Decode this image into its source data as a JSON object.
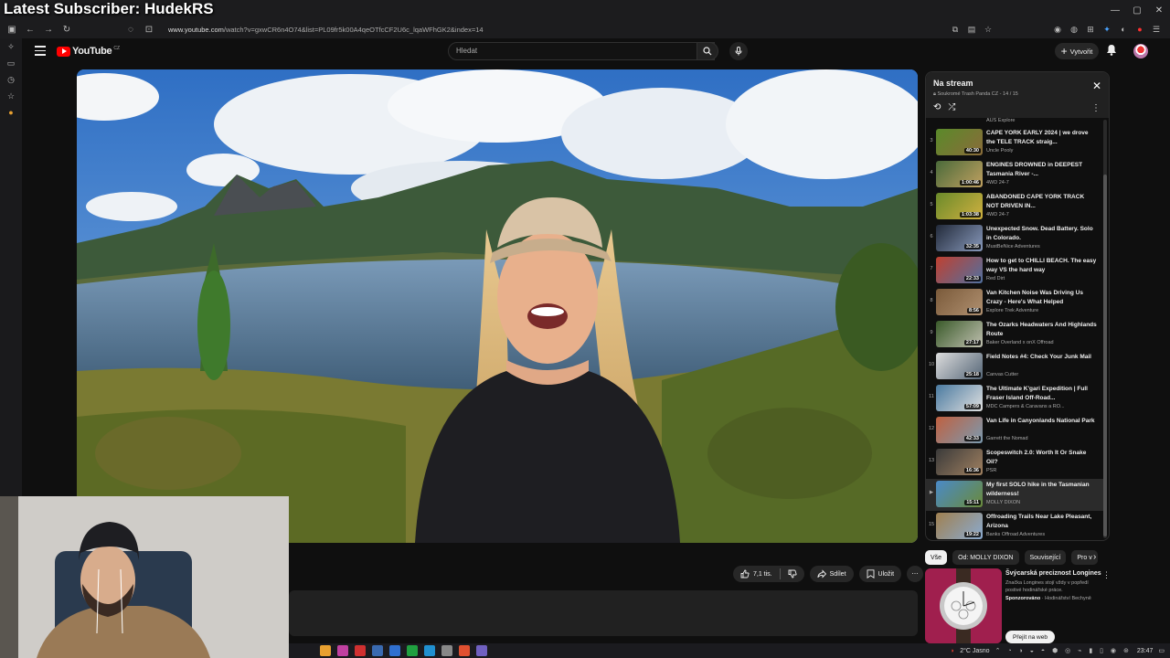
{
  "overlay": {
    "title": "Latest Subscriber: HudekRS"
  },
  "browser": {
    "url_host": "www.youtube.com",
    "url_path": "/watch?v=gxwCR6n4O74&list=PL09fr5k00A4qeOTfcCF2U6c_lqaWFhGK2&index=14"
  },
  "youtube": {
    "logo_text": "YouTube",
    "logo_region": "CZ",
    "search_placeholder": "Hledat",
    "create_label": "Vytvořit"
  },
  "actions": {
    "like_count": "7,1 tis.",
    "share_label": "Sdílet",
    "save_label": "Uložit"
  },
  "playlist": {
    "title": "Na stream",
    "privacy": "Soukromé",
    "owner": "Trash Panda CZ",
    "position": "14 / 15",
    "above_channel": "AUS Explore",
    "items": [
      {
        "index": "3",
        "title": "CAPE YORK EARLY 2024 | we drove the TELE TRACK straig...",
        "channel": "Uncle Pooly",
        "duration": "40:30",
        "colors": [
          "#5a8a2a",
          "#8a6b3a"
        ],
        "active": false
      },
      {
        "index": "4",
        "title": "ENGINES DROWNED in DEEPEST Tasmania River -...",
        "channel": "4WD 24-7",
        "duration": "1:00:46",
        "colors": [
          "#4a6a3a",
          "#c0a060"
        ],
        "active": false
      },
      {
        "index": "5",
        "title": "ABANDONED CAPE YORK TRACK NOT DRIVEN IN...",
        "channel": "4WD 24-7",
        "duration": "1:03:38",
        "colors": [
          "#6a8a2a",
          "#d0b040"
        ],
        "active": false
      },
      {
        "index": "6",
        "title": "Unexpected Snow. Dead Battery. Solo in Colorado.",
        "channel": "MustBeNice Adventures",
        "duration": "32:35",
        "colors": [
          "#222a3a",
          "#8899bb"
        ],
        "active": false
      },
      {
        "index": "7",
        "title": "How to get to CHILLI BEACH. The easy way VS the hard way",
        "channel": "Red Dirt",
        "duration": "22:33",
        "colors": [
          "#c04030",
          "#5070a0"
        ],
        "active": false
      },
      {
        "index": "8",
        "title": "Van Kitchen Noise Was Driving Us Crazy - Here's What Helped",
        "channel": "Explore Trek Adventure",
        "duration": "8:56",
        "colors": [
          "#7a5a3a",
          "#b09070"
        ],
        "active": false
      },
      {
        "index": "9",
        "title": "The Ozarks Headwaters And Highlands Route",
        "channel": "Baker Overland x onX Offroad",
        "duration": "27:17",
        "colors": [
          "#3a5a2a",
          "#c0c0b0"
        ],
        "active": false
      },
      {
        "index": "10",
        "title": "Field Notes #4: Check Your Junk Mail",
        "channel": "Canvas Cutter",
        "duration": "25:18",
        "colors": [
          "#dddddd",
          "#556677"
        ],
        "active": false
      },
      {
        "index": "11",
        "title": "The Ultimate K'gari Expedition | Full Fraser Island Off-Road...",
        "channel": "MDC Campers & Caravans a RO...",
        "duration": "57:09",
        "colors": [
          "#4a7aa0",
          "#e0e0e0"
        ],
        "active": false
      },
      {
        "index": "12",
        "title": "Van Life in Canyonlands National Park",
        "channel": "Garrett the Nomad",
        "duration": "42:33",
        "colors": [
          "#c06040",
          "#7a9ab0"
        ],
        "active": false
      },
      {
        "index": "13",
        "title": "Scopeswitch 2.0: Worth It Or Snake Oil?",
        "channel": "PSR",
        "duration": "16:36",
        "colors": [
          "#3a3a3a",
          "#a08060"
        ],
        "active": false
      },
      {
        "index": "▶",
        "title": "My first SOLO hike in the Tasmanian wilderness!",
        "channel": "MOLLY DIXON",
        "duration": "15:11",
        "colors": [
          "#4a8ac8",
          "#6a8a3a"
        ],
        "active": true
      },
      {
        "index": "15",
        "title": "Offroading Trails Near Lake Pleasant, Arizona",
        "channel": "Banks Offroad Adventures",
        "duration": "19:22",
        "colors": [
          "#a08050",
          "#8aaad0"
        ],
        "active": false
      }
    ]
  },
  "chips": [
    "Vše",
    "Od: MOLLY DIXON",
    "Související",
    "Pro v"
  ],
  "ad": {
    "title": "Švýcarská preciznost Longines",
    "description": "Značka Longines stojí vždy v popředí postivé hodinářské práce.",
    "sponsored": "Sponzorováno",
    "advertiser": "Hodinářství Bechyně",
    "cta": "Přejít na web"
  },
  "taskbar": {
    "weather": "2°C Jasno",
    "time": "23:47"
  }
}
